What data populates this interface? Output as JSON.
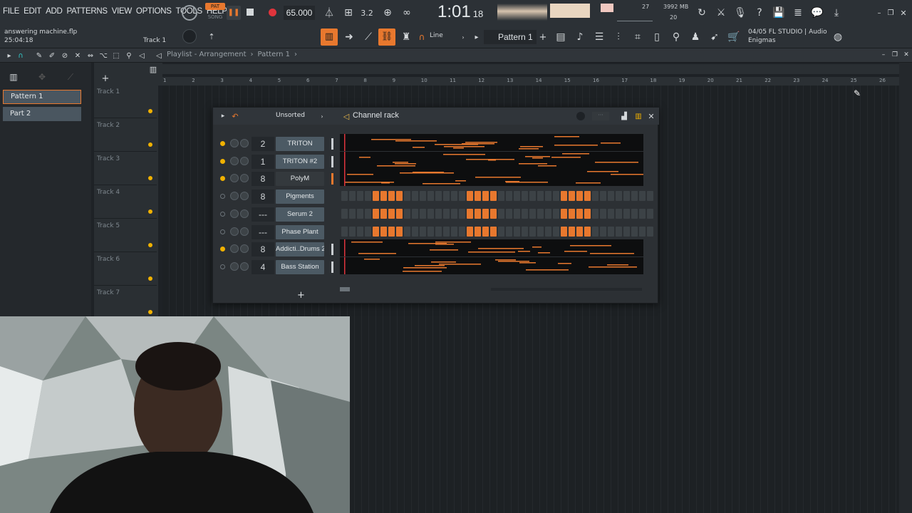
{
  "menu": [
    "FILE",
    "EDIT",
    "ADD",
    "PATTERNS",
    "VIEW",
    "OPTIONS",
    "TOOLS",
    "HELP"
  ],
  "transport": {
    "pat_label": "PAT",
    "song_label": "SONG",
    "tempo": "65.000",
    "time": "1:01",
    "time_sub": "18",
    "pattern": "Pattern 1",
    "snap": "Line"
  },
  "cpu": {
    "mem": "3992 MB",
    "voices": "27",
    "poly": "20"
  },
  "project": {
    "file": "answering machine.flp",
    "time": "25:04:18",
    "track": "Track 1"
  },
  "hint": {
    "line1": "04/05 FL STUDIO | Audio",
    "line2": "Enigmas"
  },
  "playlist": {
    "title": "Playlist - Arrangement",
    "sep": "›",
    "pattern": "Pattern 1",
    "sep2": "›"
  },
  "patterns": [
    "Pattern 1",
    "Part 2"
  ],
  "tracks": [
    "Track 1",
    "Track 2",
    "Track 3",
    "Track 4",
    "Track 5",
    "Track 6",
    "Track 7"
  ],
  "ruler": [
    "1",
    "2",
    "3",
    "4",
    "5",
    "6",
    "7",
    "8",
    "9",
    "10",
    "11",
    "12",
    "13",
    "14",
    "15",
    "16",
    "17",
    "18",
    "19",
    "20",
    "21",
    "22",
    "23",
    "24",
    "25",
    "26"
  ],
  "rack": {
    "title": "Channel rack",
    "filter": "Unsorted",
    "add": "+",
    "channels": [
      {
        "num": "2",
        "name": "TRITON",
        "led": "on",
        "type": "roll"
      },
      {
        "num": "1",
        "name": "TRITON #2",
        "led": "on",
        "type": "roll"
      },
      {
        "num": "8",
        "name": "PolyM",
        "led": "on",
        "type": "roll",
        "dark": true
      },
      {
        "num": "8",
        "name": "Pigments",
        "led": "off",
        "type": "steps"
      },
      {
        "num": "---",
        "name": "Serum 2",
        "led": "off",
        "type": "steps"
      },
      {
        "num": "---",
        "name": "Phase Plant",
        "led": "off",
        "type": "steps"
      },
      {
        "num": "8",
        "name": "Addicti..Drums 2",
        "led": "on",
        "type": "roll"
      },
      {
        "num": "4",
        "name": "Bass Station",
        "led": "off",
        "type": "roll"
      }
    ],
    "step_pattern": [
      0,
      0,
      0,
      0,
      1,
      1,
      1,
      1,
      0,
      0,
      0,
      0,
      0,
      0,
      0,
      0,
      1,
      1,
      1,
      1,
      0,
      0,
      0,
      0,
      0,
      0,
      0,
      0,
      1,
      1,
      1,
      1,
      0,
      0,
      0,
      0,
      0,
      0,
      0,
      0,
      1,
      1,
      1,
      1
    ]
  },
  "colors": {
    "accent": "#e8782e",
    "led": "#f0b100",
    "bg": "#1e2226"
  }
}
